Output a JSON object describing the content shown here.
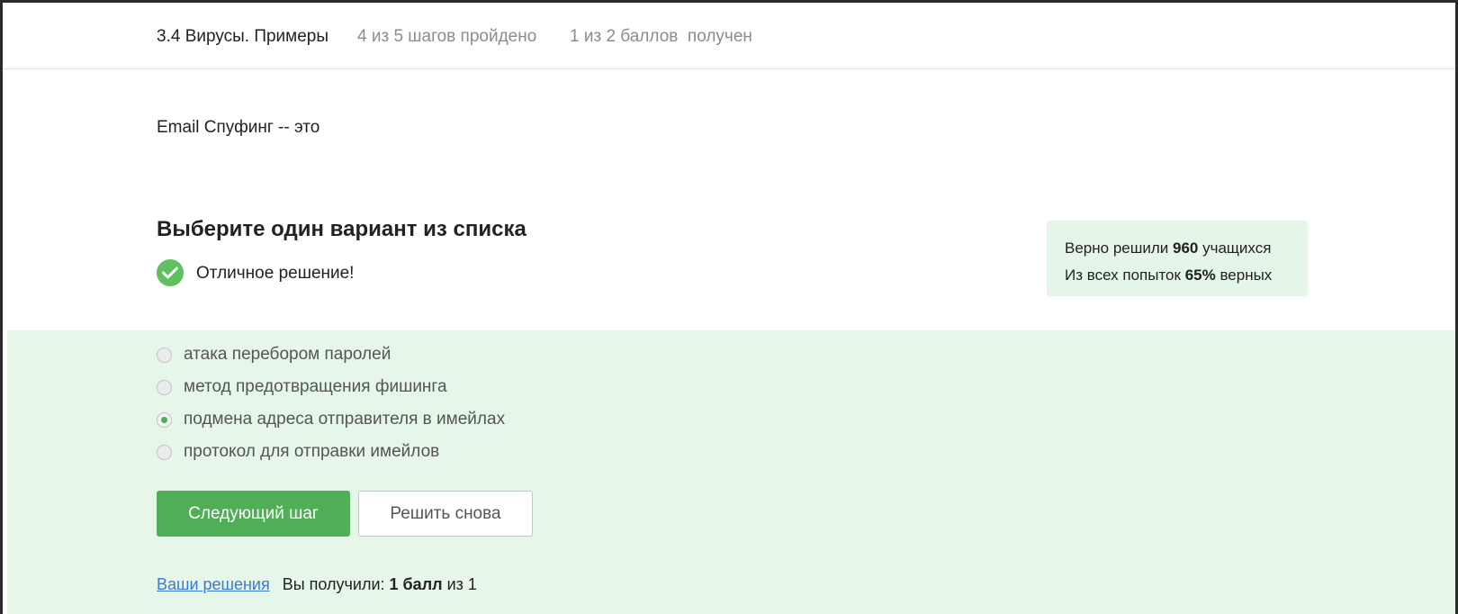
{
  "header": {
    "lesson_title": "3.4 Вирусы. Примеры",
    "steps_progress": "4 из 5 шагов пройдено",
    "points_progress": "1 из 2 баллов  получен"
  },
  "question": {
    "text": "Email Спуфинг -- это"
  },
  "quiz": {
    "heading": "Выберите один вариант из списка",
    "feedback": "Отличное решение!",
    "options": [
      {
        "label": "атака перебором паролей",
        "selected": false
      },
      {
        "label": "метод предотвращения фишинга",
        "selected": false
      },
      {
        "label": "подмена адреса отправителя в имейлах",
        "selected": true
      },
      {
        "label": "протокол для отправки имейлов",
        "selected": false
      }
    ],
    "next_button": "Следующий шаг",
    "retry_button": "Решить снова"
  },
  "stats": {
    "solved_prefix": "Верно решили ",
    "solved_count": "960",
    "solved_suffix": " учащихся",
    "attempts_prefix": "Из всех попыток ",
    "attempts_percent": "65%",
    "attempts_suffix": " верных"
  },
  "footer": {
    "solutions_link": "Ваши решения",
    "score_prefix": "Вы получили: ",
    "score_value": "1 балл",
    "score_suffix": " из 1"
  },
  "colors": {
    "accent_green": "#4fae56",
    "answer_background": "#e6f6e8",
    "link_blue": "#3a7bd5"
  }
}
